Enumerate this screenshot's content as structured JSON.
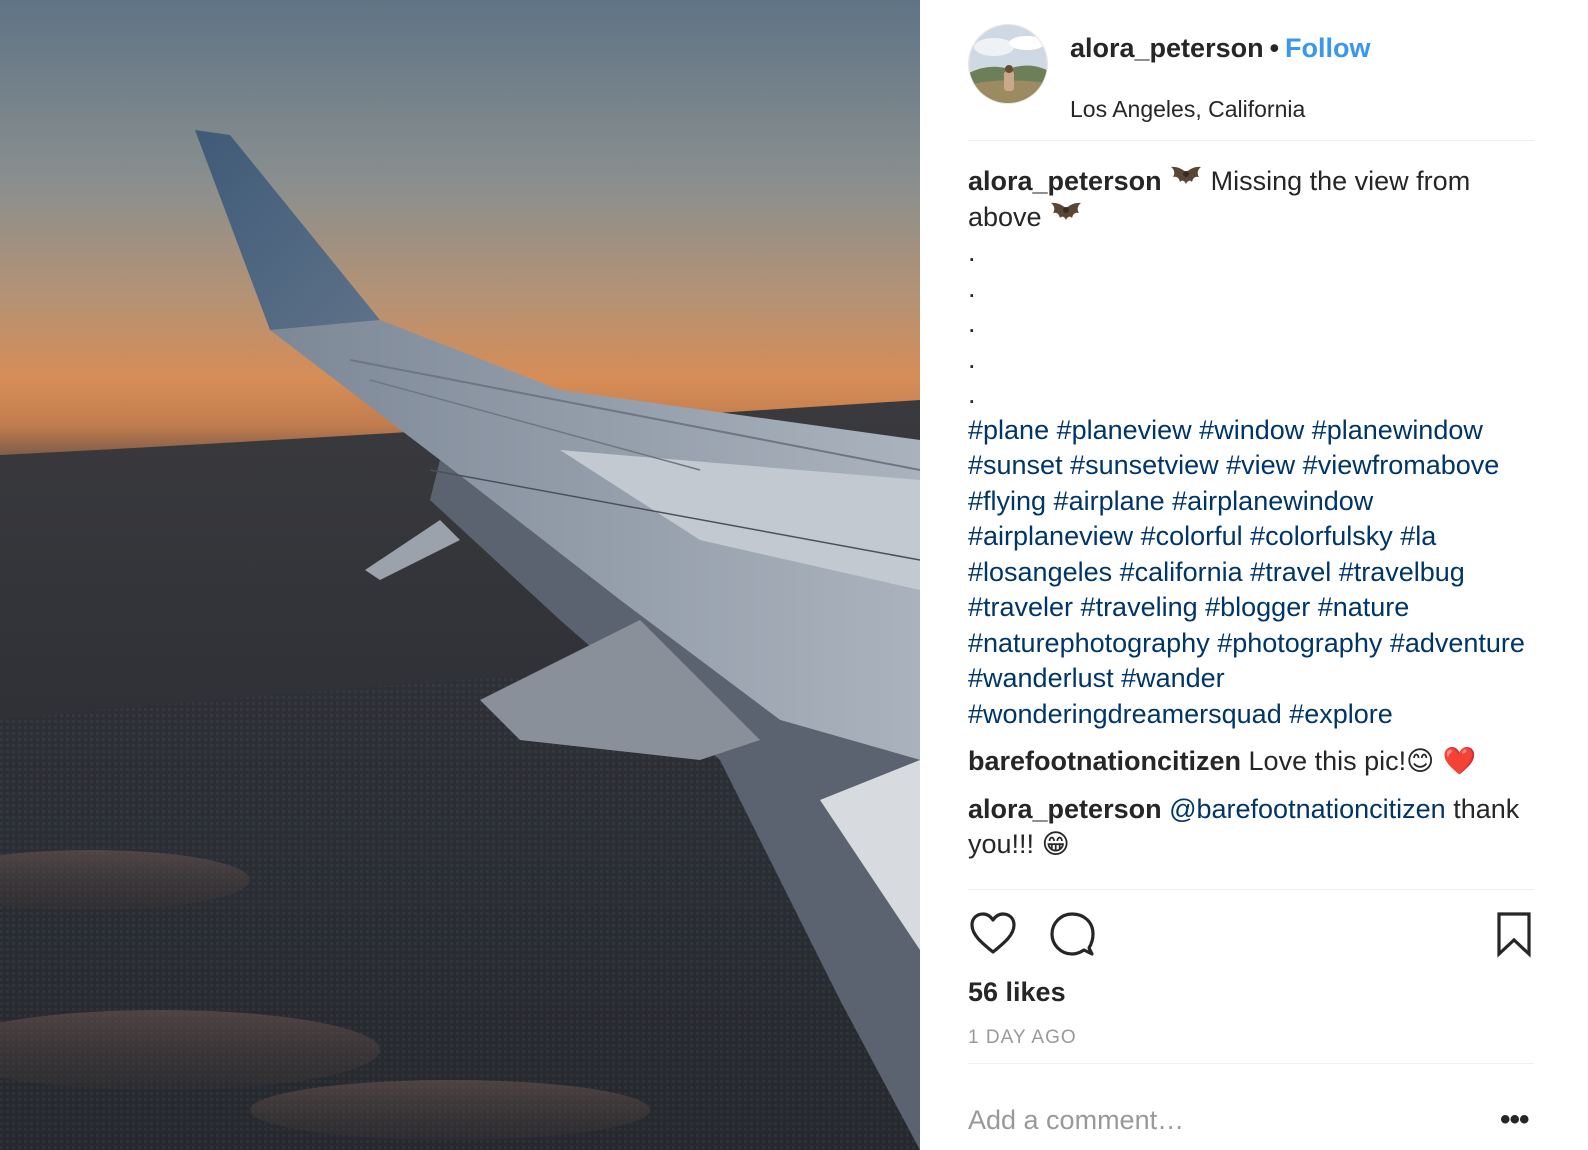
{
  "photo": {
    "subject": "airplane-wing-sunset",
    "colors": {
      "sky_top": "#6b7f90",
      "sky_glow": "#d98c55",
      "ground": "#2a2c30",
      "wing": "#9ca6b2"
    }
  },
  "header": {
    "username": "alora_peterson",
    "separator": "•",
    "follow_label": "Follow",
    "location": "Los Angeles, California"
  },
  "caption": {
    "username": "alora_peterson",
    "emoji": "bat",
    "text_before": "Missing the view from above",
    "dots": [
      ".",
      ".",
      ".",
      ".",
      "."
    ],
    "hashtags": "#plane #planeview #window #planewindow #sunset #sunsetview #view #viewfromabove #flying #airplane #airplanewindow #airplaneview #colorful #colorfulsky #la #losangeles #california #travel #travelbug #traveler #traveling #blogger #nature #naturephotography #photography #adventure #wanderlust #wander #wonderingdreamersquad #explore"
  },
  "comments": [
    {
      "username": "barefootnationcitizen",
      "text": "Love this pic!",
      "emoji": "😊 ❤️"
    },
    {
      "username": "alora_peterson",
      "mention": "@barefootnationcitizen",
      "text": "thank you!!!",
      "emoji": "😁"
    }
  ],
  "actions": {
    "like_icon": "heart-outline-icon",
    "comment_icon": "speech-bubble-icon",
    "save_icon": "bookmark-icon"
  },
  "likes_text": "56 likes",
  "timestamp": "1 DAY AGO",
  "add_comment_placeholder": "Add a comment…",
  "more_label": "•••",
  "colors": {
    "link_blue": "#3897f0",
    "hashtag": "#003569",
    "muted": "#999999",
    "text": "#262626",
    "divider": "#efefef"
  }
}
